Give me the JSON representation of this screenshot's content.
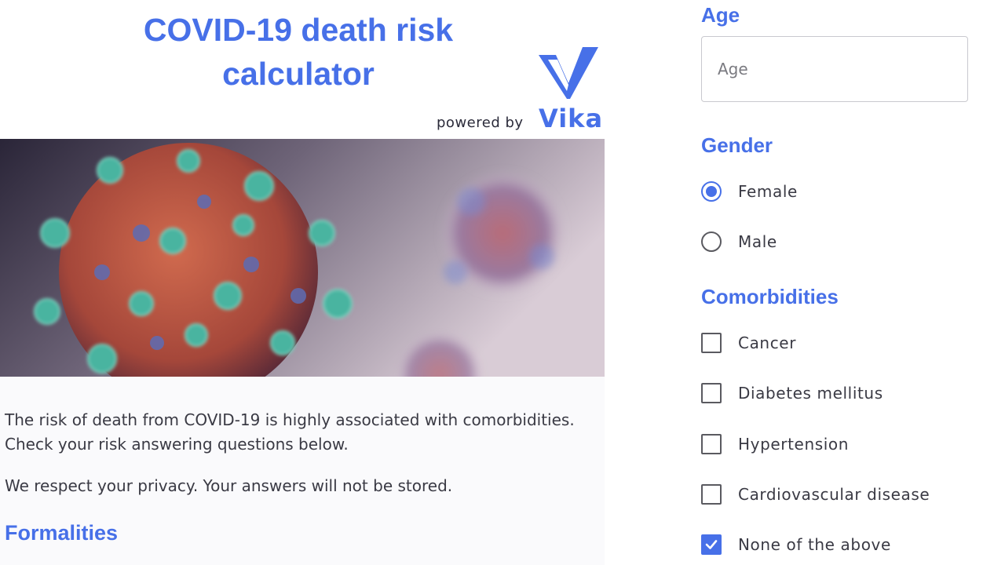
{
  "header": {
    "title_line1": "COVID-19 death risk",
    "title_line2": "calculator",
    "powered_by": "powered by",
    "brand": "Vika"
  },
  "intro": {
    "description": "The risk of death from COVID-19 is highly associated with comorbidities. Check your risk answering questions below.",
    "privacy": "We respect your privacy. Your answers will not be stored.",
    "section_heading": "Formalities"
  },
  "form": {
    "age": {
      "label": "Age",
      "placeholder": "Age",
      "value": ""
    },
    "gender": {
      "label": "Gender",
      "options": [
        {
          "label": "Female",
          "selected": true
        },
        {
          "label": "Male",
          "selected": false
        }
      ]
    },
    "comorbidities": {
      "label": "Comorbidities",
      "options": [
        {
          "label": "Cancer",
          "checked": false
        },
        {
          "label": "Diabetes mellitus",
          "checked": false
        },
        {
          "label": "Hypertension",
          "checked": false
        },
        {
          "label": "Cardiovascular disease",
          "checked": false
        },
        {
          "label": "None of the above",
          "checked": true
        }
      ]
    }
  },
  "colors": {
    "accent": "#4770e8",
    "text": "#3a3a44"
  },
  "icons": {
    "logo": "vika-v-logo-icon",
    "hero": "coronavirus-image"
  }
}
